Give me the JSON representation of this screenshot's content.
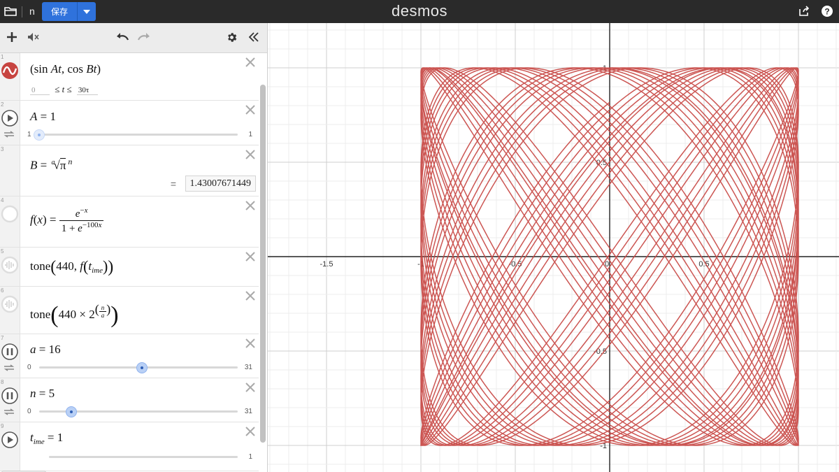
{
  "topbar": {
    "graph_title": "n",
    "save_label": "保存",
    "logo": "desmos"
  },
  "expressions": [
    {
      "num": "1",
      "kind": "parametric",
      "t_min": "0",
      "t_max": "30τ",
      "color": "#c74440"
    },
    {
      "num": "2",
      "kind": "slider",
      "name": "A",
      "value": "1",
      "min": "1",
      "max": "1",
      "fraction": 0.0
    },
    {
      "num": "3",
      "kind": "expression",
      "value": "1.43007671449"
    },
    {
      "num": "4",
      "kind": "function"
    },
    {
      "num": "5",
      "kind": "tone"
    },
    {
      "num": "6",
      "kind": "tone"
    },
    {
      "num": "7",
      "kind": "slider",
      "name": "a",
      "value": "16",
      "min": "0",
      "max": "31",
      "fraction": 0.516
    },
    {
      "num": "8",
      "kind": "slider",
      "name": "n",
      "value": "5",
      "min": "0",
      "max": "31",
      "fraction": 0.161
    },
    {
      "num": "9",
      "kind": "slider",
      "name": "t_time",
      "value": "1",
      "min": "",
      "max": "1",
      "fraction": 0.0
    }
  ],
  "graph": {
    "x_ticks": [
      "-1.5",
      "-1",
      "-0.5",
      "0",
      "0.5"
    ],
    "y_ticks": [
      "1",
      "0.5",
      "-0.5",
      "-1"
    ],
    "curve_color": "#c74440",
    "params": {
      "A": 1,
      "B": 1.43007671449,
      "t_min": 0,
      "t_max_over_tau": 30
    }
  }
}
